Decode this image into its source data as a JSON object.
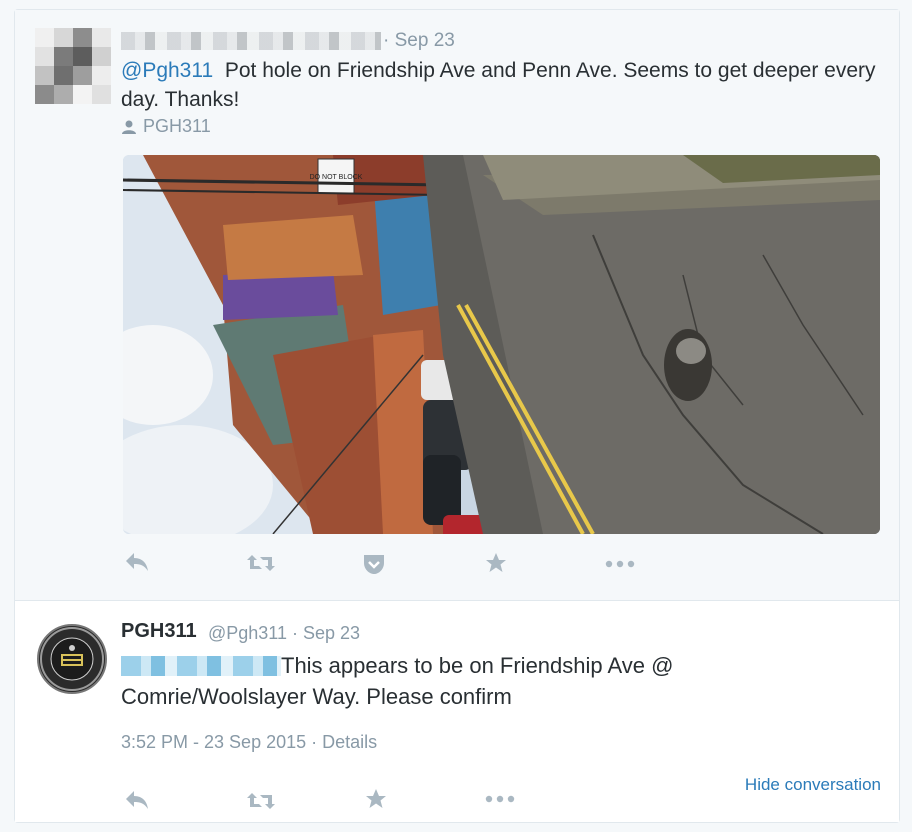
{
  "tweet1": {
    "date": "· Sep 23",
    "mention": "@Pgh311",
    "text": "  Pot hole on Friendship Ave and Penn Ave. Seems to get deeper every day. Thanks!",
    "via": "PGH311",
    "photo_sign": "DO NOT BLOCK"
  },
  "tweet2": {
    "name": "PGH311",
    "handle": "@Pgh311 · Sep 23",
    "text": "This appears to be on Friendship Ave @ Comrie/Woolslayer Way. Please confirm",
    "timestamp": "3:52 PM - 23 Sep 2015 · Details",
    "hide_conversation": "Hide conversation"
  },
  "icons": {
    "reply": "reply-icon",
    "retweet": "retweet-icon",
    "pocket": "pocket-icon",
    "favorite": "star-icon",
    "more": "more-icon",
    "person": "person-icon"
  },
  "colors": {
    "link": "#2b7bb9",
    "muted": "#8899a6",
    "icon": "#aab8c2"
  }
}
